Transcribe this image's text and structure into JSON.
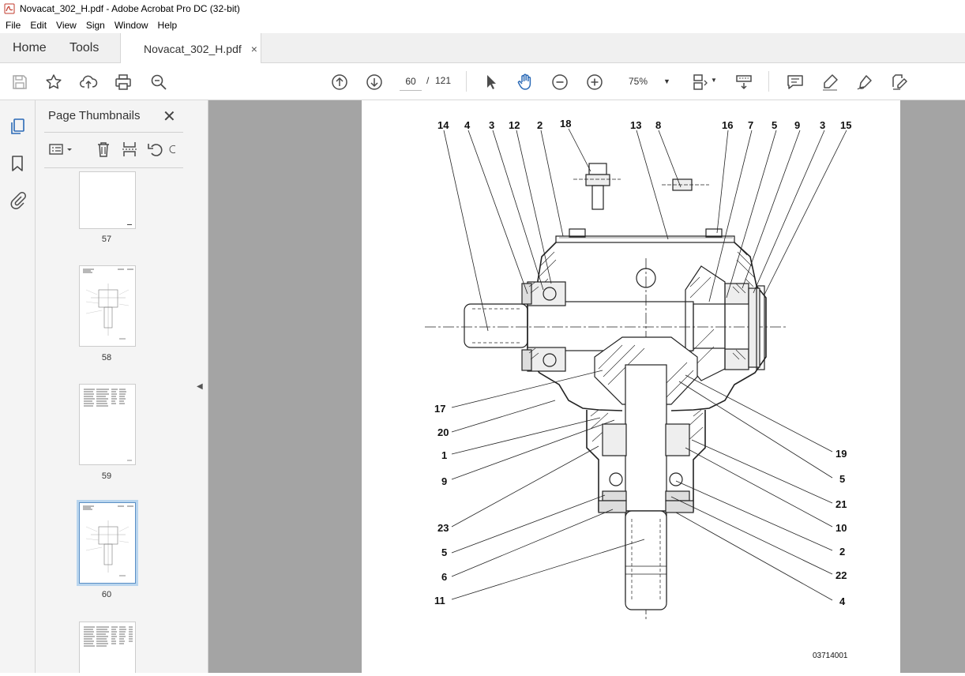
{
  "window": {
    "title": "Novacat_302_H.pdf - Adobe Acrobat Pro DC (32-bit)"
  },
  "menu": [
    "File",
    "Edit",
    "View",
    "Sign",
    "Window",
    "Help"
  ],
  "tabs": {
    "home": "Home",
    "tools": "Tools",
    "document": "Novacat_302_H.pdf",
    "close": "×"
  },
  "toolbar": {
    "current_page": "60",
    "page_separator": "/",
    "total_pages": "121",
    "zoom": "75%",
    "icons": [
      "save-icon",
      "bookmark-star-icon",
      "upload-icon",
      "print-icon",
      "zoom-search-icon",
      "page-up-icon",
      "page-down-icon",
      "select-arrow-icon",
      "hand-icon",
      "zoom-out-icon",
      "zoom-in-icon",
      "page-view-icon",
      "scroll-mode-icon",
      "comment-icon",
      "highlight-icon",
      "draw-icon",
      "fill-sign-icon"
    ]
  },
  "left_rail": {
    "icons": [
      "page-thumbnails-icon",
      "bookmarks-icon",
      "attachments-icon"
    ]
  },
  "thumbnails_panel": {
    "title": "Page Thumbnails",
    "close": "✕",
    "pages": [
      {
        "label": "57"
      },
      {
        "label": "58"
      },
      {
        "label": "59"
      },
      {
        "label": "60",
        "selected": true
      },
      {
        "label": ""
      }
    ]
  },
  "drawing": {
    "callouts_top": [
      "14",
      "4",
      "3",
      "12",
      "2",
      "18",
      "13",
      "8",
      "16",
      "7",
      "5",
      "9",
      "3",
      "15"
    ],
    "callouts_left": [
      "17",
      "20",
      "1",
      "9",
      "23",
      "5",
      "6",
      "11"
    ],
    "callouts_right": [
      "19",
      "5",
      "21",
      "10",
      "2",
      "22",
      "4"
    ],
    "figure_number": "03714001"
  },
  "colors": {
    "accent_blue": "#2b6ab6",
    "icon_gray": "#4b4b4b",
    "doc_bg": "#a4a4a4"
  }
}
